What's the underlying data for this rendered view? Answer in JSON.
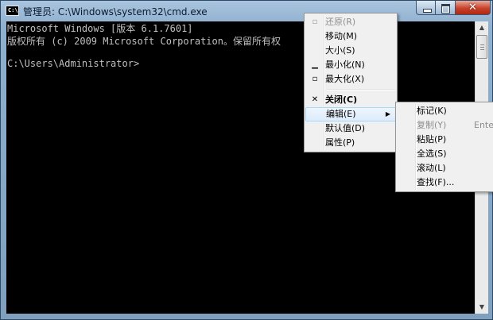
{
  "window": {
    "title": "管理员: C:\\Windows\\system32\\cmd.exe",
    "icon_label": "C:\\",
    "close_glyph": "✕"
  },
  "console": {
    "lines": [
      "Microsoft Windows [版本 6.1.7601]",
      "版权所有 (c) 2009 Microsoft Corporation。保留所有权",
      "",
      "C:\\Users\\Administrator>"
    ]
  },
  "system_menu": {
    "items": [
      {
        "label": "还原(R)",
        "icon": "restore-icon",
        "disabled": true
      },
      {
        "label": "移动(M)"
      },
      {
        "label": "大小(S)"
      },
      {
        "label": "最小化(N)",
        "icon": "minimize-icon"
      },
      {
        "label": "最大化(X)",
        "icon": "maximize-icon"
      },
      {
        "label": "关闭(C)",
        "icon": "close-icon",
        "bold": true
      },
      {
        "label": "编辑(E)",
        "highlighted": true,
        "has_submenu": true
      },
      {
        "label": "默认值(D)"
      },
      {
        "label": "属性(P)"
      }
    ]
  },
  "edit_submenu": {
    "items": [
      {
        "label": "标记(K)"
      },
      {
        "label": "复制(Y)",
        "shortcut": "Ente",
        "disabled": true
      },
      {
        "label": "粘贴(P)"
      },
      {
        "label": "全选(S)"
      },
      {
        "label": "滚动(L)"
      },
      {
        "label": "查找(F)..."
      }
    ]
  },
  "colors": {
    "console_bg": "#000000",
    "console_fg": "#c0c0c0",
    "menu_highlight": "#dcebfc"
  }
}
